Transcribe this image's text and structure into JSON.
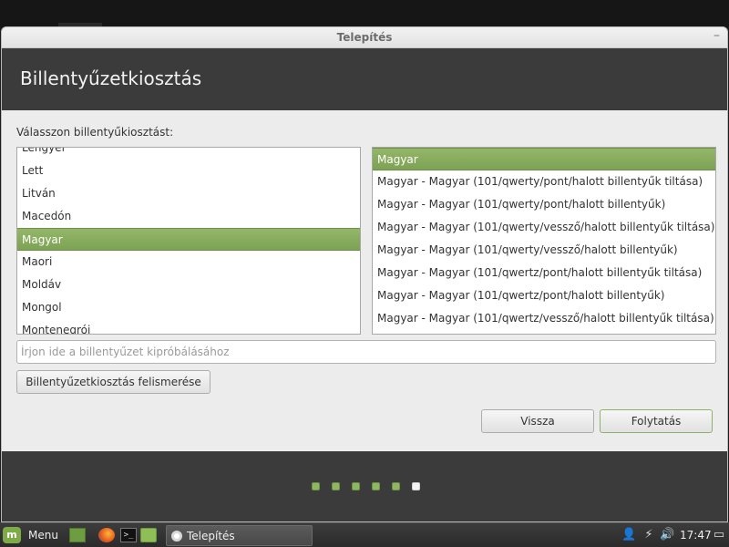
{
  "window": {
    "title": "Telepítés",
    "minimize_glyph": "–"
  },
  "header": {
    "title": "Billentyűzetkiosztás"
  },
  "prompt": "Válasszon billentyűkiosztást:",
  "layouts": {
    "items": [
      "Lengyel",
      "Lett",
      "Litván",
      "Macedón",
      "Magyar",
      "Maori",
      "Moldáv",
      "Mongol",
      "Montenegrói"
    ],
    "selected": "Magyar"
  },
  "variants": {
    "items": [
      "Magyar",
      "Magyar - Magyar (101/qwerty/pont/halott billentyűk tiltása)",
      "Magyar - Magyar (101/qwerty/pont/halott billentyűk)",
      "Magyar - Magyar (101/qwerty/vessző/halott billentyűk tiltása)",
      "Magyar - Magyar (101/qwerty/vessző/halott billentyűk)",
      "Magyar - Magyar (101/qwertz/pont/halott billentyűk tiltása)",
      "Magyar - Magyar (101/qwertz/pont/halott billentyűk)",
      "Magyar - Magyar (101/qwertz/vessző/halott billentyűk tiltása)"
    ],
    "selected": "Magyar"
  },
  "test_input": {
    "value": "",
    "placeholder": "Írjon ide a billentyűzet kipróbálásához"
  },
  "buttons": {
    "detect": "Billentyűzetkiosztás felismerése",
    "back": "Vissza",
    "continue": "Folytatás"
  },
  "progress": {
    "total_steps": 6,
    "current_step": 6
  },
  "colors": {
    "accent": "#87ac5d",
    "header_bg": "#3b3b3b",
    "window_bg": "#ececec"
  },
  "taskbar": {
    "menu_label": "Menu",
    "launchers": [
      "show-desktop-icon",
      "firefox-icon",
      "terminal-icon",
      "files-icon"
    ],
    "terminal_glyph": ">_",
    "task_label": "Telepítés",
    "clock": "17:47",
    "tray": [
      {
        "name": "user-icon",
        "glyph": "👤"
      },
      {
        "name": "network-icon",
        "glyph": "⚡"
      },
      {
        "name": "volume-icon",
        "glyph": "🔊"
      },
      {
        "name": "display-icon",
        "glyph": "▭"
      }
    ]
  }
}
